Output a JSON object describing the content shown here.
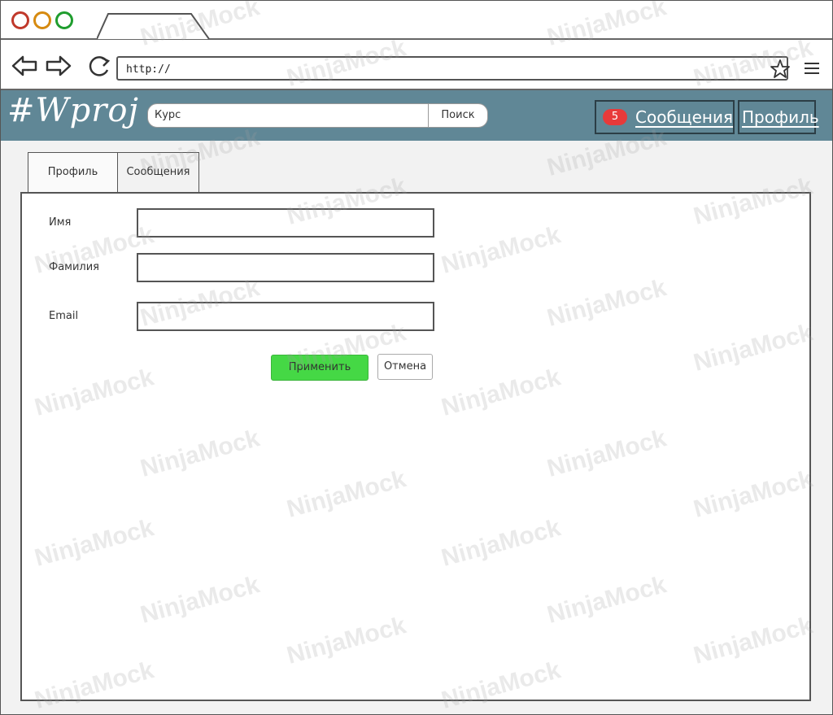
{
  "browser": {
    "url": "http://",
    "icons": [
      "back-icon",
      "forward-icon",
      "reload-icon",
      "star-icon",
      "menu-icon"
    ]
  },
  "header": {
    "logo": "#Wproj",
    "search_value": "Курс",
    "search_button": "Поиск",
    "messages_badge": "5",
    "messages_label": "Сообщения",
    "profile_label": "Профиль",
    "bg_color": "#608796"
  },
  "tabs": [
    {
      "label": "Профиль"
    },
    {
      "label": "Сообщения"
    }
  ],
  "form": {
    "fields": [
      {
        "label": "Имя",
        "value": ""
      },
      {
        "label": "Фамилия",
        "value": ""
      },
      {
        "label": "Email",
        "value": ""
      }
    ],
    "apply_label": "Применить",
    "cancel_label": "Отмена",
    "apply_color": "#45d845"
  },
  "watermark": "NinjaMock"
}
